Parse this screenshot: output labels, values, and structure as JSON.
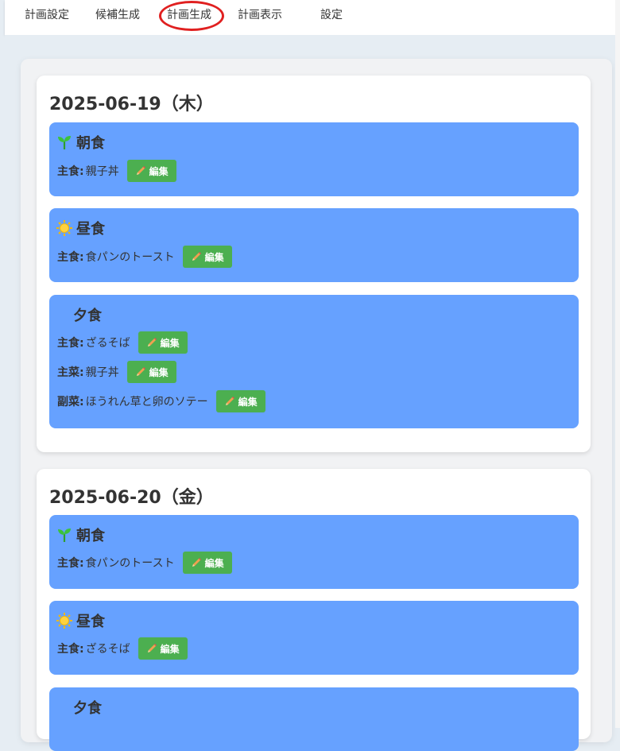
{
  "nav": {
    "tabs": [
      "計画設定",
      "候補生成",
      "計画生成",
      "計画表示",
      "設定"
    ],
    "highlighted_tab": "計画生成",
    "highlight_color": "#e02020"
  },
  "colors": {
    "meal_bg": "#66a1ff",
    "edit_button_bg": "#4caf50",
    "page_bg": "#e6edf3"
  },
  "edit_label": "編集",
  "days": [
    {
      "date": "2025-06-19（木）",
      "meals": [
        {
          "icon": "seedling-icon",
          "name": "朝食",
          "dishes": [
            {
              "label": "主食:",
              "name": "親子丼"
            }
          ]
        },
        {
          "icon": "sun-icon",
          "name": "昼食",
          "dishes": [
            {
              "label": "主食:",
              "name": "食パンのトースト"
            }
          ]
        },
        {
          "icon": "moon-icon",
          "name": "夕食",
          "dishes": [
            {
              "label": "主食:",
              "name": "ざるそば"
            },
            {
              "label": "主菜:",
              "name": "親子丼"
            },
            {
              "label": "副菜:",
              "name": "ほうれん草と卵のソテー"
            }
          ]
        }
      ]
    },
    {
      "date": "2025-06-20（金）",
      "meals": [
        {
          "icon": "seedling-icon",
          "name": "朝食",
          "dishes": [
            {
              "label": "主食:",
              "name": "食パンのトースト"
            }
          ]
        },
        {
          "icon": "sun-icon",
          "name": "昼食",
          "dishes": [
            {
              "label": "主食:",
              "name": "ざるそば"
            }
          ]
        },
        {
          "icon": "moon-icon",
          "name": "夕食",
          "dishes": []
        }
      ]
    }
  ]
}
